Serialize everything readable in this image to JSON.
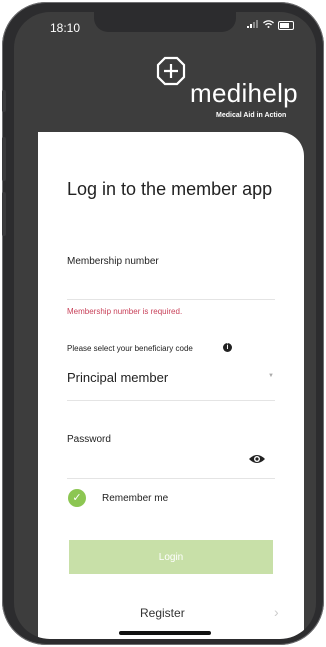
{
  "status_bar": {
    "time": "18:10",
    "signal_icon": "signal-bars-icon",
    "wifi_icon": "wifi-icon",
    "battery_icon": "battery-icon"
  },
  "brand": {
    "name": "medihelp",
    "tagline": "Medical Aid in Action",
    "mark_icon": "medihelp-logo-mark"
  },
  "login": {
    "title": "Log in to the member app",
    "membership": {
      "label": "Membership number",
      "value": "",
      "error": "Membership number is required."
    },
    "beneficiary": {
      "label": "Please select your beneficiary code",
      "info_icon": "info-icon",
      "value": "Principal member",
      "caret_icon": "dropdown-caret-icon"
    },
    "password": {
      "label": "Password",
      "value": "",
      "toggle_icon": "eye-icon"
    },
    "remember": {
      "label": "Remember me",
      "checked": true,
      "check_icon": "checkmark-icon"
    },
    "login_button": "Login",
    "register_label": "Register",
    "register_icon": "chevron-right-icon"
  },
  "colors": {
    "accent": "#8cc652",
    "button_disabled": "#c8e0a8",
    "error": "#c8425a",
    "header_bg": "#3d3d3d"
  }
}
